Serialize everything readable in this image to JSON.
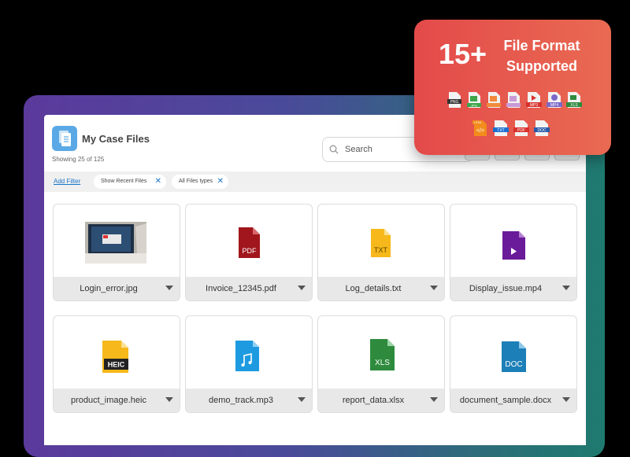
{
  "header": {
    "title": "My Case Files",
    "subtitle": "Showing 25 of 125",
    "search_placeholder": "Search"
  },
  "filters": {
    "add_filter": "Add Filter",
    "chips": [
      {
        "label": "Show Recent Files"
      },
      {
        "label": "All Files types"
      }
    ]
  },
  "files": [
    {
      "name": "Login_error.jpg",
      "type": "image-preview"
    },
    {
      "name": "Invoice_12345.pdf",
      "type": "PDF",
      "color": "#a0161c"
    },
    {
      "name": "Log_details.txt",
      "type": "TXT",
      "color": "#f6b81a"
    },
    {
      "name": "Display_issue.mp4",
      "type": "video",
      "color": "#6a1b9a"
    },
    {
      "name": "product_image.heic",
      "type": "HEIC",
      "color": "#f6b81a"
    },
    {
      "name": "demo_track.mp3",
      "type": "audio",
      "color": "#1e9be0"
    },
    {
      "name": "report_data.xlsx",
      "type": "XLS",
      "color": "#2e8b3d"
    },
    {
      "name": "document_sample.docx",
      "type": "DOC",
      "color": "#1d7fb8"
    }
  ],
  "badge": {
    "count": "15+",
    "line1": "File Format",
    "line2": "Supported",
    "formats": [
      {
        "label": "PNG",
        "color": "#e3e3e3"
      },
      {
        "label": "JPG",
        "color": "#3ea64a"
      },
      {
        "label": "",
        "color": "#f18b3b"
      },
      {
        "label": "",
        "color": "#c99ad6"
      },
      {
        "label": "MP3",
        "color": "#d9302c"
      },
      {
        "label": "MP4",
        "color": "#7b68c9"
      },
      {
        "label": "XLS",
        "color": "#2e8b3d"
      },
      {
        "label": "HTML",
        "color": "#f28c1c"
      },
      {
        "label": "TXT",
        "color": "#1e6fd0"
      },
      {
        "label": "PDF",
        "color": "#d9302c"
      },
      {
        "label": "DOC",
        "color": "#2b5aa8"
      }
    ]
  }
}
